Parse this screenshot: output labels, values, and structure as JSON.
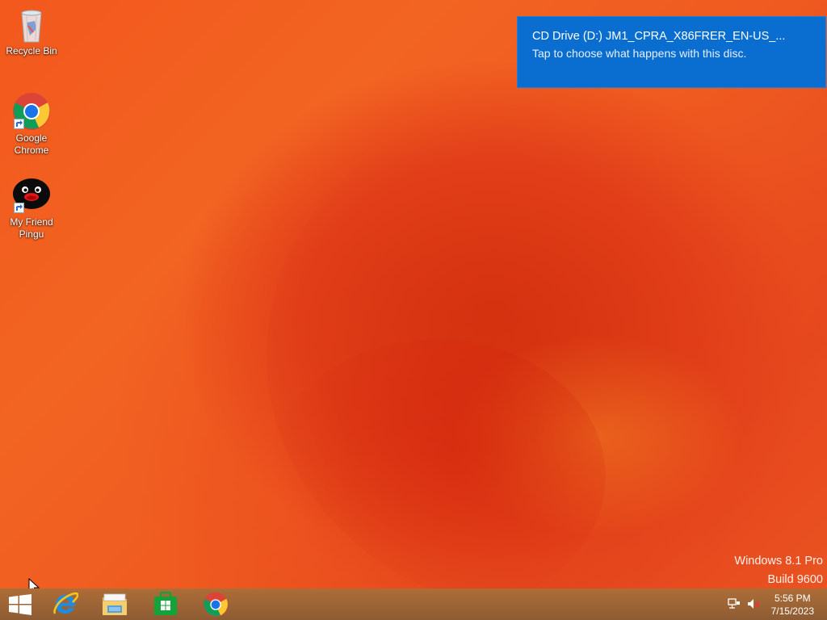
{
  "desktop": {
    "icons": [
      {
        "label": "Recycle Bin",
        "icon": "recycle-bin-icon"
      },
      {
        "label": "Google\nChrome",
        "icon": "chrome-icon"
      },
      {
        "label": "My Friend\nPingu",
        "icon": "pingu-icon"
      }
    ]
  },
  "notification": {
    "title": "CD Drive (D:) JM1_CPRA_X86FRER_EN-US_...",
    "message": "Tap to choose what happens with this disc.",
    "color": "#0a6ed1"
  },
  "watermark": {
    "edition": "Windows 8.1 Pro",
    "build": "Build 9600"
  },
  "taskbar": {
    "start": {
      "icon": "windows-logo-icon"
    },
    "pinned": [
      {
        "icon": "internet-explorer-icon"
      },
      {
        "icon": "file-explorer-icon"
      },
      {
        "icon": "windows-store-icon"
      },
      {
        "icon": "chrome-icon"
      }
    ],
    "tray": {
      "network_icon": "network-icon",
      "volume_icon": "volume-muted-icon",
      "time": "5:56 PM",
      "date": "7/15/2023"
    }
  },
  "colors": {
    "wallpaper_primary": "#f05a1e",
    "wallpaper_dark": "#d93512",
    "taskbar": "#9a6a3c"
  }
}
